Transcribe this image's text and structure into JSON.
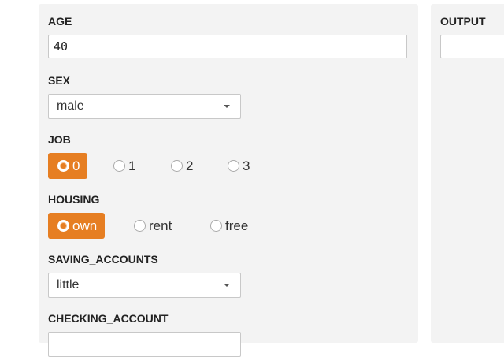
{
  "form": {
    "age": {
      "label": "AGE",
      "value": "40"
    },
    "sex": {
      "label": "SEX",
      "selected": "male"
    },
    "job": {
      "label": "JOB",
      "options": [
        "0",
        "1",
        "2",
        "3"
      ],
      "selected": "0"
    },
    "housing": {
      "label": "HOUSING",
      "options": [
        "own",
        "rent",
        "free"
      ],
      "selected": "own"
    },
    "saving_accounts": {
      "label": "SAVING_ACCOUNTS",
      "selected": "little"
    },
    "checking_account": {
      "label": "CHECKING_ACCOUNT",
      "selected": ""
    }
  },
  "output": {
    "label": "OUTPUT",
    "value": ""
  },
  "colors": {
    "accent": "#e67e22",
    "panel_bg": "#f3f3f3",
    "border": "#c8c8c8"
  },
  "icons": {
    "dropdown": "chevron-down-icon",
    "radio": "radio-icon"
  }
}
